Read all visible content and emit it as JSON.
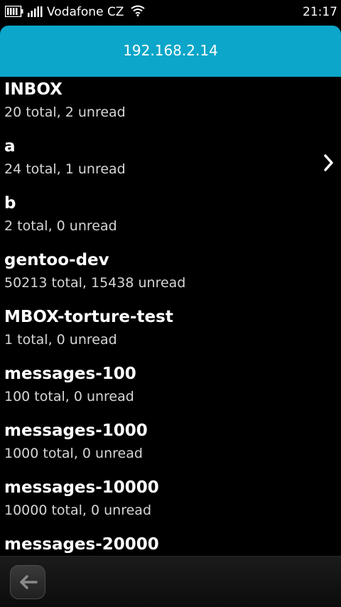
{
  "status_bar": {
    "carrier": "Vodafone CZ",
    "time": "21:17",
    "icons": [
      "battery-icon",
      "signal-icon",
      "wifi-icon"
    ]
  },
  "header": {
    "title": "192.168.2.14",
    "color": "#0ba6c9"
  },
  "folders": [
    {
      "name": "INBOX",
      "stats": "20 total, 2 unread"
    },
    {
      "name": "a",
      "stats": "24 total, 1 unread"
    },
    {
      "name": "b",
      "stats": "2 total, 0 unread"
    },
    {
      "name": "gentoo-dev",
      "stats": "50213 total, 15438 unread"
    },
    {
      "name": "MBOX-torture-test",
      "stats": "1 total, 0 unread"
    },
    {
      "name": "messages-100",
      "stats": "100 total, 0 unread"
    },
    {
      "name": "messages-1000",
      "stats": "1000 total, 0 unread"
    },
    {
      "name": "messages-10000",
      "stats": "10000 total, 0 unread"
    },
    {
      "name": "messages-20000",
      "stats": ""
    }
  ],
  "toolbar": {
    "back_icon": "back-arrow-icon"
  }
}
